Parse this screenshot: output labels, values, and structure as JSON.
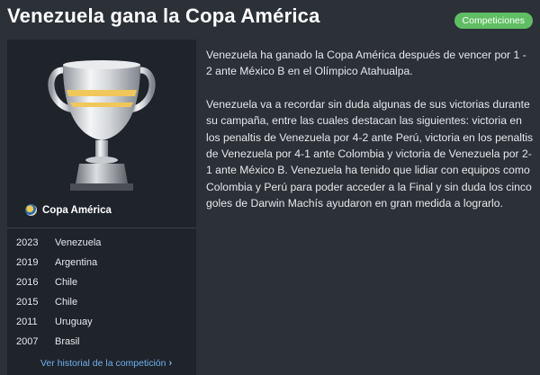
{
  "header": {
    "title": "Venezuela gana la Copa América",
    "badge": "Competiciones"
  },
  "sidebar": {
    "competition": "Copa América",
    "winners": [
      {
        "year": "2023",
        "team": "Venezuela"
      },
      {
        "year": "2019",
        "team": "Argentina"
      },
      {
        "year": "2016",
        "team": "Chile"
      },
      {
        "year": "2015",
        "team": "Chile"
      },
      {
        "year": "2011",
        "team": "Uruguay"
      },
      {
        "year": "2007",
        "team": "Brasil"
      }
    ],
    "history_link": "Ver historial de la competición"
  },
  "article": {
    "paragraphs": [
      "Venezuela ha ganado la Copa América después de vencer por 1 - 2 ante México B en el Olímpico Atahualpa.",
      "Venezuela va a recordar sin duda algunas de sus victorias durante su campaña, entre las cuales destacan las siguientes: victoria en los penaltis de Venezuela por 4-2 ante Perú, victoria en los penaltis de Venezuela por 4-1 ante Colombia y victoria de Venezuela por 2-1 ante México B. Venezuela ha tenido que lidiar con equipos como Colombia y Perú para poder acceder a la Final y sin duda los cinco goles de Darwin Machís ayudaron en gran medida a lograrlo."
    ]
  },
  "icons": {
    "trophy": "trophy-icon",
    "competition_logo": "competition-logo-icon",
    "chevron": "chevron-right-icon"
  },
  "colors": {
    "background": "#2c3037",
    "sidebar": "#1f232a",
    "badge": "#5fbe63",
    "link": "#6fb1f0",
    "trophy_band": "#f0c75a"
  }
}
